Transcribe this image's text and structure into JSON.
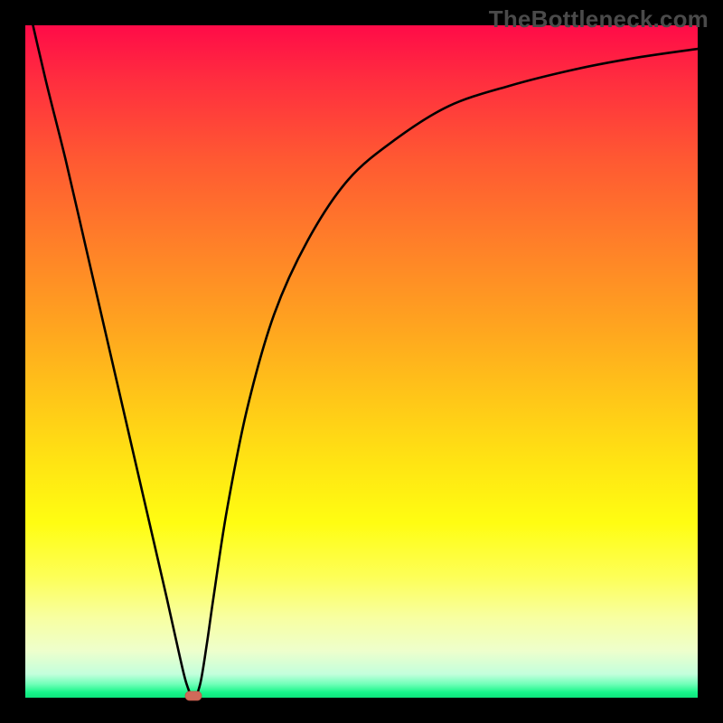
{
  "watermark": "TheBottleneck.com",
  "chart_data": {
    "type": "line",
    "title": "",
    "xlabel": "",
    "ylabel": "",
    "xlim": [
      0,
      100
    ],
    "ylim": [
      0,
      100
    ],
    "grid": false,
    "series": [
      {
        "name": "bottleneck-curve",
        "x": [
          0,
          3,
          6,
          9,
          12,
          15,
          18,
          21,
          23,
          24,
          25,
          26,
          27,
          28,
          30,
          33,
          37,
          42,
          48,
          55,
          63,
          72,
          82,
          91,
          100
        ],
        "values": [
          105,
          92,
          80,
          67,
          54,
          41,
          28,
          15,
          6,
          2,
          0,
          2,
          8,
          15,
          28,
          43,
          57,
          68,
          77,
          83,
          88,
          91,
          93.5,
          95.2,
          96.5
        ]
      }
    ],
    "annotations": [
      {
        "name": "valley-marker",
        "x": 25,
        "y": 0,
        "shape": "pill",
        "color": "#d06a5a"
      }
    ],
    "background": {
      "type": "vertical-gradient",
      "stops": [
        {
          "pos": 0,
          "color": "#ff0b48"
        },
        {
          "pos": 0.45,
          "color": "#ffa51f"
        },
        {
          "pos": 0.74,
          "color": "#fffd12"
        },
        {
          "pos": 0.97,
          "color": "#6fffb8"
        },
        {
          "pos": 1.0,
          "color": "#0ee47d"
        }
      ]
    }
  }
}
